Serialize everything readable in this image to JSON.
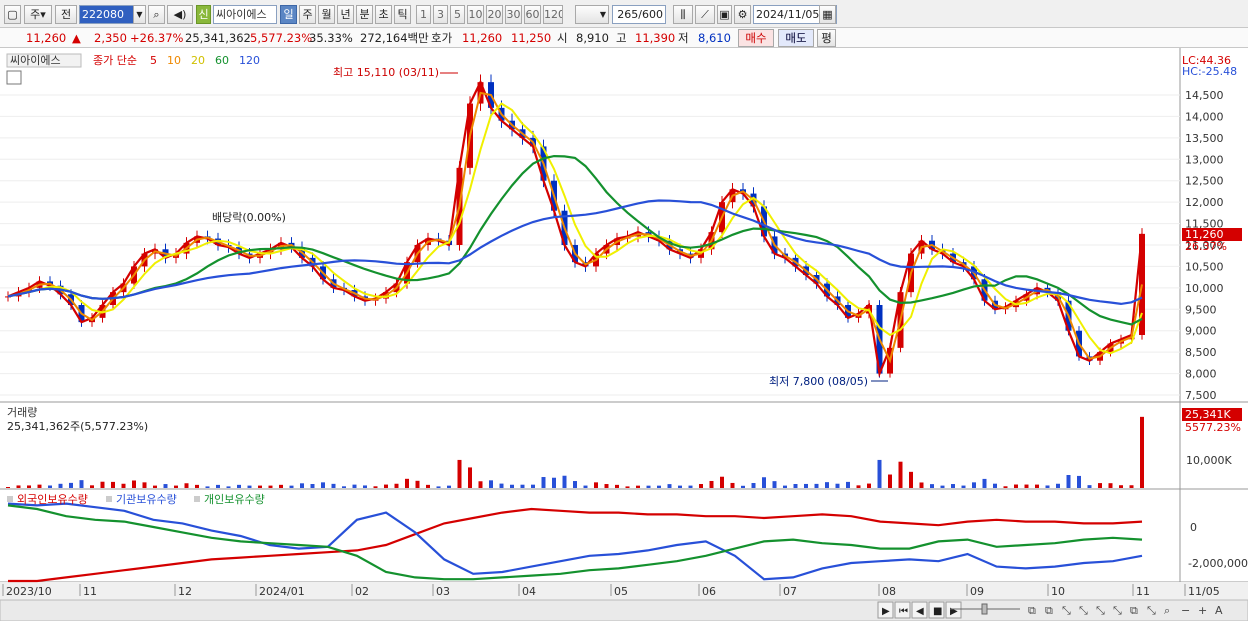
{
  "toolbar": {
    "tab_stock": "주",
    "tab_prev": "전",
    "code": "222080",
    "new_label": "신",
    "name": "씨아이에스",
    "periods": [
      "일",
      "주",
      "월",
      "년",
      "분",
      "초",
      "틱"
    ],
    "active_period": "일",
    "intervals": [
      "1",
      "3",
      "5",
      "10",
      "20",
      "30",
      "60",
      "120"
    ],
    "count": "265",
    "count_total": "/600",
    "date": "2024/11/05"
  },
  "quote": {
    "price": "11,260",
    "change": "2,350",
    "change_rate": "+26.37%",
    "volume": "25,341,362",
    "volume_rate": "5,577.23%",
    "turnover": "35.33%",
    "amount": "272,164백만",
    "hoga_label": "호가",
    "ask": "11,260",
    "bid": "11,250",
    "open_label": "시",
    "open": "8,910",
    "high_label": "고",
    "high": "11,390",
    "low_label": "저",
    "low": "8,610",
    "buy": "매수",
    "sell": "매도",
    "eval": "평"
  },
  "chart_data": {
    "type": "candlestick",
    "legend": {
      "name": "씨아이에스",
      "ma_label": "종가 단순",
      "ma": [
        {
          "period": "5",
          "color": "#d40000"
        },
        {
          "period": "10",
          "color": "#ee8800"
        },
        {
          "period": "20",
          "color": "#f0f000"
        },
        {
          "period": "60",
          "color": "#14912e"
        },
        {
          "period": "120",
          "color": "#2850d8"
        }
      ]
    },
    "price_axis": {
      "ticks": [
        "14,500",
        "14,000",
        "13,500",
        "13,000",
        "12,500",
        "12,000",
        "11,500",
        "11,000",
        "10,500",
        "10,000",
        "9,500",
        "9,000",
        "8,500",
        "8,000",
        "7,500"
      ],
      "ylim": [
        7500,
        14500
      ]
    },
    "lc": "LC:44.36",
    "hc": "HC:-25.48",
    "current_price": "11,260",
    "current_rate": "26.37%",
    "annotations": {
      "high": "최고 15,110 (03/11)",
      "low": "최저 7,800 (08/05)",
      "dividend": "배당락(0.00%)"
    },
    "closes": [
      9800,
      9900,
      10000,
      10150,
      10050,
      9850,
      9600,
      9200,
      9300,
      9600,
      9900,
      10100,
      10500,
      10800,
      10900,
      10700,
      10800,
      11050,
      11200,
      11150,
      11000,
      10950,
      10800,
      10700,
      10800,
      10900,
      11050,
      10950,
      10700,
      10500,
      10200,
      10000,
      9950,
      9800,
      9700,
      9750,
      9900,
      10100,
      10600,
      11000,
      11150,
      11100,
      11000,
      12800,
      14300,
      14800,
      14200,
      13900,
      13700,
      13500,
      13300,
      12500,
      11800,
      11000,
      10600,
      10500,
      10800,
      11000,
      11150,
      11200,
      11300,
      11200,
      11100,
      10900,
      10800,
      10700,
      10900,
      11300,
      12000,
      12300,
      12200,
      11900,
      11200,
      10800,
      10700,
      10500,
      10300,
      10100,
      9800,
      9600,
      9300,
      9400,
      9600,
      8000,
      8600,
      9900,
      10800,
      11100,
      10900,
      10800,
      10600,
      10500,
      10200,
      9700,
      9500,
      9550,
      9700,
      9850,
      10000,
      9900,
      9700,
      9000,
      8400,
      8300,
      8500,
      8700,
      8800,
      8900,
      11260
    ],
    "volume": {
      "label": "거래량",
      "value": "25,341,362주(5,577.23%)",
      "tick": "10,000K",
      "current": "25,341K",
      "current_rate": "5577.23%"
    },
    "holdings": {
      "labels": [
        "외국인보유수량",
        "기관보유수량",
        "개인보유수량"
      ],
      "colors": [
        "#d40000",
        "#2850d8",
        "#14912e"
      ],
      "ticks": [
        "0",
        "-2,000,000"
      ],
      "foreign": [
        -3.0,
        -3.0,
        -2.8,
        -2.6,
        -2.4,
        -2.2,
        -2.0,
        -1.8,
        -1.7,
        -1.6,
        -1.5,
        -1.4,
        -1.3,
        -1.0,
        -0.4,
        0.2,
        0.5,
        0.8,
        1.0,
        0.9,
        0.8,
        0.8,
        0.7,
        0.7,
        0.6,
        0.6,
        0.5,
        0.6,
        0.7,
        0.6,
        0.3,
        0.2,
        0.1,
        0.3,
        0.4,
        0.3,
        0.3,
        0.2,
        0.2,
        0.3
      ],
      "inst": [
        1.3,
        1.2,
        1.3,
        1.1,
        0.9,
        0.4,
        0.2,
        -0.2,
        -0.5,
        -1.0,
        -1.2,
        -1.1,
        0.4,
        0.8,
        -0.3,
        -1.8,
        -2.6,
        -2.5,
        -2.2,
        -1.9,
        -1.6,
        -1.5,
        -1.3,
        -1.0,
        -0.8,
        -1.6,
        -2.9,
        -2.8,
        -2.3,
        -2.0,
        -1.9,
        -1.8,
        -1.9,
        -1.5,
        -2.2,
        -2.3,
        -2.2,
        -2.0,
        -1.9,
        -1.6
      ],
      "indiv": [
        1.2,
        1.0,
        0.6,
        0.4,
        0.3,
        0.0,
        -0.3,
        -0.6,
        -0.8,
        -0.9,
        -1.0,
        -1.1,
        -1.6,
        -2.5,
        -2.8,
        -2.9,
        -2.9,
        -2.8,
        -2.7,
        -2.6,
        -2.4,
        -2.3,
        -2.1,
        -1.9,
        -1.6,
        -1.2,
        -0.8,
        -0.7,
        -0.9,
        -1.0,
        -1.2,
        -1.2,
        -0.8,
        -0.7,
        -1.1,
        -1.0,
        -0.9,
        -0.7,
        -0.6,
        -0.7
      ]
    },
    "x_axis": {
      "labels": [
        "2023/10",
        "11",
        "12",
        "2024/01",
        "02",
        "03",
        "04",
        "05",
        "06",
        "07",
        "08",
        "09",
        "10",
        "11",
        "11/05"
      ]
    }
  }
}
